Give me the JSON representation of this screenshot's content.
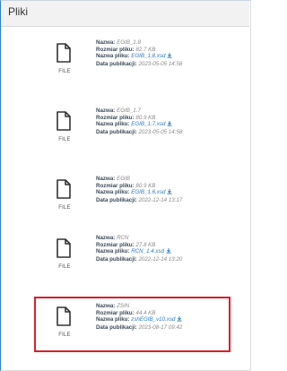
{
  "panel": {
    "title": "Pliki"
  },
  "labels": {
    "name": "Nazwa:",
    "size": "Rozmiar pliku:",
    "filename": "Nazwa pliku:",
    "date": "Data publikacji:"
  },
  "file_type_label": "FILE",
  "files": [
    {
      "name": "EGIB_1.8",
      "size": "82.7 KB",
      "filename": "EGIB_1.8.xsd",
      "date": "2023-05-05 14:58"
    },
    {
      "name": "EGIB_1.7",
      "size": "80.9 KB",
      "filename": "EGIB_1.7.xsd",
      "date": "2023-05-05 14:58"
    },
    {
      "name": "EGIB",
      "size": "80.9 KB",
      "filename": "EGIB_1.6.xsd",
      "date": "2022-12-14 13:17"
    },
    {
      "name": "RCN",
      "size": "27.8 KB",
      "filename": "RCN_1.4.xsd",
      "date": "2022-12-14 13:20"
    },
    {
      "name": "ZSIN",
      "size": "44.4 KB",
      "filename": "zshEGIB_v10.xsd",
      "date": "2023-08-17 09:42"
    }
  ],
  "colors": {
    "accent": "#2b7cc3",
    "highlight": "#d91f2b"
  }
}
